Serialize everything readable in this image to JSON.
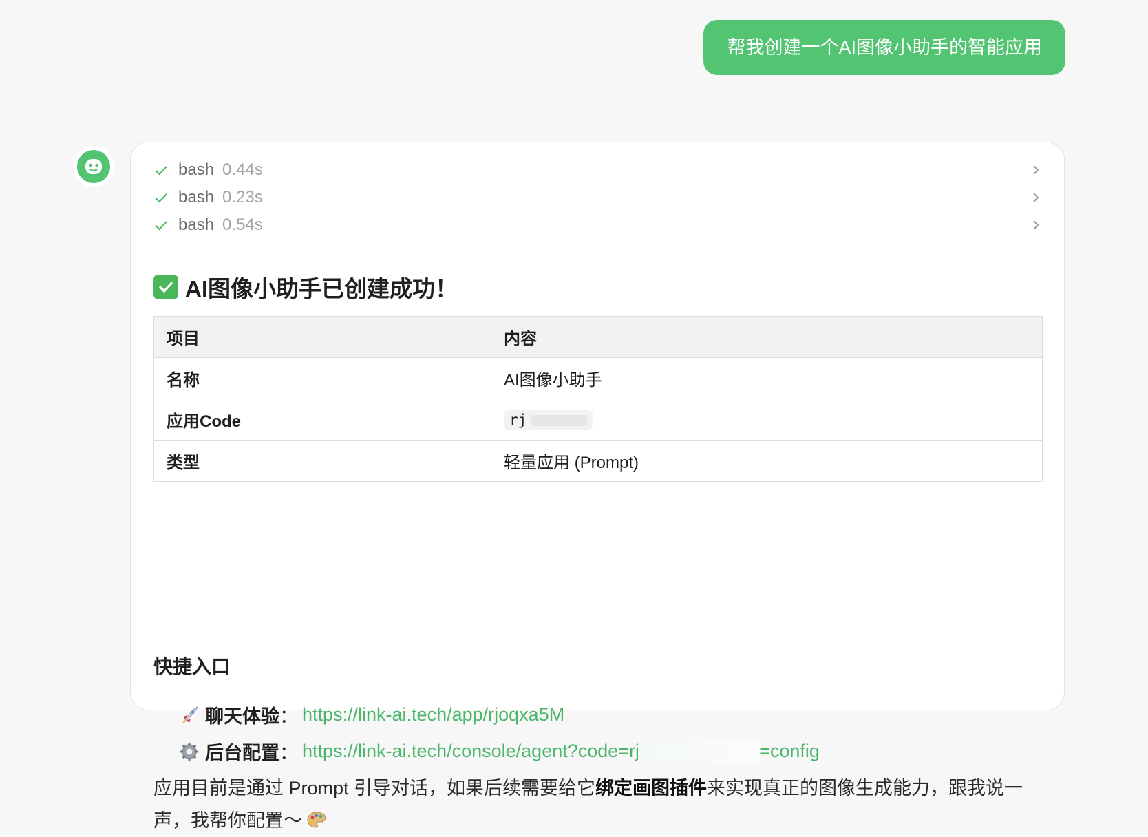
{
  "user_message": "帮我创建一个AI图像小助手的智能应用",
  "assistant": {
    "tool_calls": [
      {
        "name": "bash",
        "duration": "0.44s"
      },
      {
        "name": "bash",
        "duration": "0.23s"
      },
      {
        "name": "bash",
        "duration": "0.54s"
      }
    ],
    "heading": "AI图像小助手已创建成功！",
    "table": {
      "headers": [
        "项目",
        "内容"
      ],
      "rows": [
        {
          "key": "名称",
          "value": "AI图像小助手"
        },
        {
          "key": "应用Code",
          "value": "rj"
        },
        {
          "key": "类型",
          "value": "轻量应用 (Prompt)"
        }
      ]
    },
    "shortcuts_heading": "快捷入口",
    "shortcuts": [
      {
        "icon": "rocket-icon",
        "label": "聊天体验",
        "colon": "：",
        "url_start": "https://link-ai.tech/app/rjoqxa5M",
        "url_end": ""
      },
      {
        "icon": "gear-icon",
        "label": "后台配置",
        "colon": "：",
        "url_start": "https://link-ai.tech/console/agent?code=rj",
        "url_end": "=config"
      }
    ],
    "closing": {
      "part1": "应用目前是通过 Prompt 引导对话，如果后续需要给它",
      "bold": "绑定画图插件",
      "part2": "来实现真正的图像生成能力，跟我说一声，我帮你配置～"
    }
  },
  "colors": {
    "accent": "#52c472",
    "link": "#4bb56b",
    "check": "#49b65a"
  }
}
